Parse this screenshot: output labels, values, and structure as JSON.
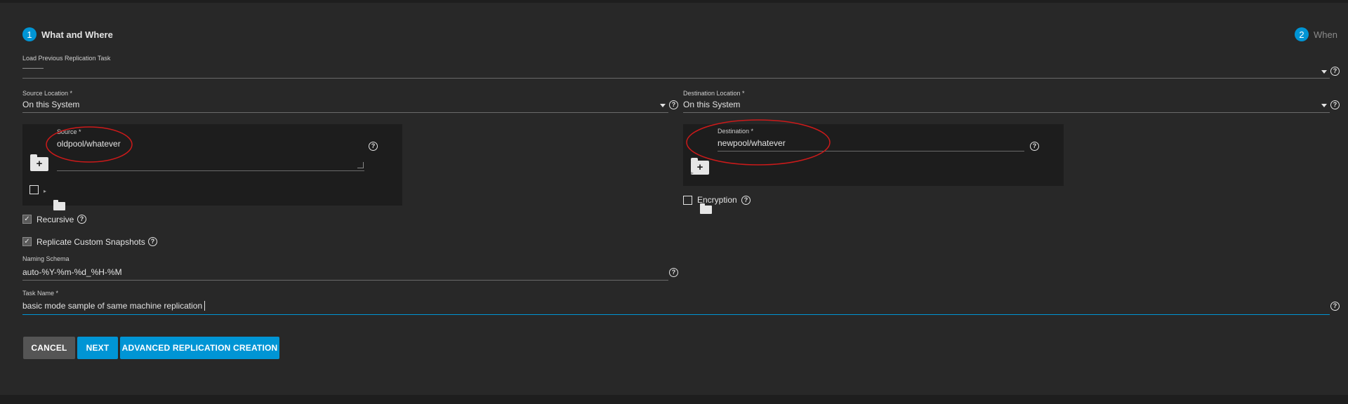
{
  "steps": [
    {
      "number": "1",
      "label": "What and Where"
    },
    {
      "number": "2",
      "label": "When"
    }
  ],
  "load_previous": {
    "label": "Load Previous Replication Task",
    "value": "———"
  },
  "source_location": {
    "label": "Source Location *",
    "value": "On this System"
  },
  "destination_location": {
    "label": "Destination Location *",
    "value": "On this System"
  },
  "source": {
    "label": "Source *",
    "value": "oldpool/whatever"
  },
  "destination": {
    "label": "Destination *",
    "value": "newpool/whatever"
  },
  "encryption": {
    "label": "Encryption",
    "checked": false
  },
  "recursive": {
    "label": "Recursive",
    "checked": true
  },
  "replicate_custom": {
    "label": "Replicate Custom Snapshots",
    "checked": true
  },
  "naming_schema": {
    "label": "Naming Schema",
    "value": "auto-%Y-%m-%d_%H-%M"
  },
  "task_name": {
    "label": "Task Name *",
    "value": "basic mode sample of same machine replication"
  },
  "buttons": {
    "cancel": "CANCEL",
    "next": "NEXT",
    "advanced": "ADVANCED REPLICATION CREATION"
  },
  "help_glyph": "?",
  "check_glyph": "✓",
  "add_glyph": "+",
  "triangle_glyph": "▸",
  "colors": {
    "accent": "#0095d5",
    "background": "#282828",
    "panel": "#1d1d1d",
    "annotation": "#cc1a1a"
  }
}
